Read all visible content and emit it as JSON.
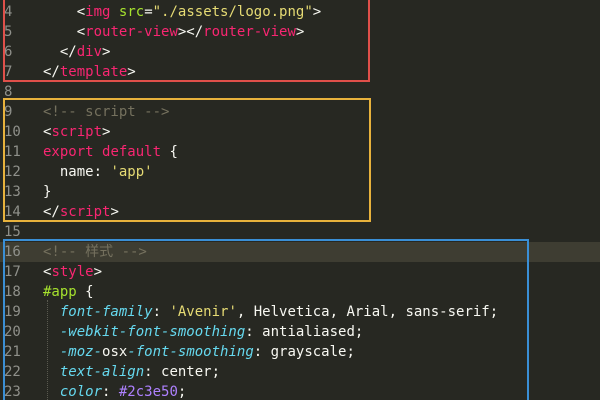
{
  "editor": {
    "colors": {
      "background": "#272822",
      "current_line": "#3e3d32",
      "line_number": "#8f908a",
      "template_box": "#e0504a",
      "script_box": "#e8b23c",
      "style_box": "#3a8fd6"
    },
    "lines": [
      {
        "n": "4",
        "current": false,
        "tokens": [
          {
            "t": "    ",
            "c": "plain"
          },
          {
            "t": "<",
            "c": "plain"
          },
          {
            "t": "img",
            "c": "tag"
          },
          {
            "t": " ",
            "c": "plain"
          },
          {
            "t": "src",
            "c": "attr"
          },
          {
            "t": "=",
            "c": "plain"
          },
          {
            "t": "\"./assets/logo.png\"",
            "c": "str"
          },
          {
            "t": ">",
            "c": "plain"
          }
        ]
      },
      {
        "n": "5",
        "current": false,
        "tokens": [
          {
            "t": "    ",
            "c": "plain"
          },
          {
            "t": "<",
            "c": "plain"
          },
          {
            "t": "router-view",
            "c": "tag"
          },
          {
            "t": "></",
            "c": "plain"
          },
          {
            "t": "router-view",
            "c": "tag"
          },
          {
            "t": ">",
            "c": "plain"
          }
        ]
      },
      {
        "n": "6",
        "current": false,
        "tokens": [
          {
            "t": "  ",
            "c": "plain"
          },
          {
            "t": "</",
            "c": "plain"
          },
          {
            "t": "div",
            "c": "tag"
          },
          {
            "t": ">",
            "c": "plain"
          }
        ]
      },
      {
        "n": "7",
        "current": false,
        "tokens": [
          {
            "t": "</",
            "c": "plain"
          },
          {
            "t": "template",
            "c": "tag"
          },
          {
            "t": ">",
            "c": "plain"
          }
        ]
      },
      {
        "n": "8",
        "current": false,
        "tokens": []
      },
      {
        "n": "9",
        "current": false,
        "tokens": [
          {
            "t": "<!-- script -->",
            "c": "cmt"
          }
        ]
      },
      {
        "n": "10",
        "current": false,
        "tokens": [
          {
            "t": "<",
            "c": "plain"
          },
          {
            "t": "script",
            "c": "tag"
          },
          {
            "t": ">",
            "c": "plain"
          }
        ]
      },
      {
        "n": "11",
        "current": false,
        "tokens": [
          {
            "t": "export",
            "c": "kw"
          },
          {
            "t": " ",
            "c": "plain"
          },
          {
            "t": "default",
            "c": "kw"
          },
          {
            "t": " {",
            "c": "plain"
          }
        ]
      },
      {
        "n": "12",
        "current": false,
        "tokens": [
          {
            "t": "  name: ",
            "c": "plain"
          },
          {
            "t": "'app'",
            "c": "str"
          }
        ]
      },
      {
        "n": "13",
        "current": false,
        "tokens": [
          {
            "t": "}",
            "c": "plain"
          }
        ]
      },
      {
        "n": "14",
        "current": false,
        "tokens": [
          {
            "t": "</",
            "c": "plain"
          },
          {
            "t": "script",
            "c": "tag"
          },
          {
            "t": ">",
            "c": "plain"
          }
        ]
      },
      {
        "n": "15",
        "current": false,
        "tokens": []
      },
      {
        "n": "16",
        "current": true,
        "tokens": [
          {
            "t": "<!-- 样式 -->",
            "c": "cmt"
          }
        ]
      },
      {
        "n": "17",
        "current": false,
        "tokens": [
          {
            "t": "<",
            "c": "plain"
          },
          {
            "t": "style",
            "c": "tag"
          },
          {
            "t": ">",
            "c": "plain"
          }
        ]
      },
      {
        "n": "18",
        "current": false,
        "tokens": [
          {
            "t": "#app",
            "c": "sel"
          },
          {
            "t": " {",
            "c": "plain"
          }
        ]
      },
      {
        "n": "19",
        "current": false,
        "tokens": [
          {
            "t": "  ",
            "c": "plain"
          },
          {
            "t": "font-family",
            "c": "prop"
          },
          {
            "t": ": ",
            "c": "plain"
          },
          {
            "t": "'Avenir'",
            "c": "str"
          },
          {
            "t": ", Helvetica, Arial, sans-serif;",
            "c": "plain"
          }
        ]
      },
      {
        "n": "20",
        "current": false,
        "tokens": [
          {
            "t": "  ",
            "c": "plain"
          },
          {
            "t": "-webkit-font-smoothing",
            "c": "prop"
          },
          {
            "t": ": antialiased;",
            "c": "plain"
          }
        ]
      },
      {
        "n": "21",
        "current": false,
        "tokens": [
          {
            "t": "  ",
            "c": "plain"
          },
          {
            "t": "-moz-",
            "c": "prop"
          },
          {
            "t": "osx",
            "c": "plain"
          },
          {
            "t": "-font-smoothing",
            "c": "prop"
          },
          {
            "t": ": grayscale;",
            "c": "plain"
          }
        ]
      },
      {
        "n": "22",
        "current": false,
        "tokens": [
          {
            "t": "  ",
            "c": "plain"
          },
          {
            "t": "text-align",
            "c": "prop"
          },
          {
            "t": ": center;",
            "c": "plain"
          }
        ]
      },
      {
        "n": "23",
        "current": false,
        "tokens": [
          {
            "t": "  ",
            "c": "plain"
          },
          {
            "t": "color",
            "c": "prop"
          },
          {
            "t": ": ",
            "c": "plain"
          },
          {
            "t": "#2c3e50",
            "c": "num"
          },
          {
            "t": ";",
            "c": "plain"
          }
        ]
      }
    ]
  }
}
